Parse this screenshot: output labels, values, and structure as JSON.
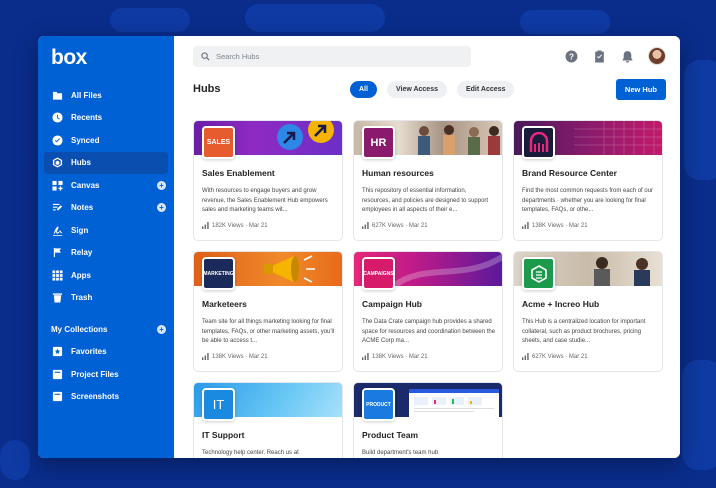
{
  "app": {
    "logo": "box"
  },
  "sidebar": {
    "items": [
      {
        "label": "All Files",
        "icon": "folder-icon"
      },
      {
        "label": "Recents",
        "icon": "clock-icon"
      },
      {
        "label": "Synced",
        "icon": "check-circle-icon"
      },
      {
        "label": "Hubs",
        "icon": "hub-icon",
        "active": true
      },
      {
        "label": "Canvas",
        "icon": "canvas-icon",
        "plus": true
      },
      {
        "label": "Notes",
        "icon": "notes-icon",
        "plus": true
      },
      {
        "label": "Sign",
        "icon": "sign-icon"
      },
      {
        "label": "Relay",
        "icon": "relay-icon"
      },
      {
        "label": "Apps",
        "icon": "apps-grid-icon"
      },
      {
        "label": "Trash",
        "icon": "trash-icon"
      }
    ],
    "collections_label": "My Collections",
    "collections": [
      {
        "label": "Favorites",
        "icon": "favorites-icon"
      },
      {
        "label": "Project Files",
        "icon": "collection-icon"
      },
      {
        "label": "Screenshots",
        "icon": "collection-icon"
      }
    ]
  },
  "search": {
    "placeholder": "Search Hubs"
  },
  "header": {
    "title": "Hubs",
    "filters": [
      "All",
      "View Access",
      "Edit Access"
    ],
    "new_hub_label": "New Hub"
  },
  "colors": {
    "brand": "#0061d5",
    "background": "#0a2d8c"
  },
  "hubs": [
    {
      "title": "Sales Enablement",
      "logo_text": "SALES",
      "desc": "With resources to engage buyers and grow revenue, the Sales Enablement Hub empowers sales and marketing teams wit...",
      "meta": "182K Views · Mar 21"
    },
    {
      "title": "Human resources",
      "logo_text": "HR",
      "desc": "This repository of essential information, resources, and policies are designed to support employees in all aspects of their e...",
      "meta": "627K Views · Mar 21"
    },
    {
      "title": "Brand Resource Center",
      "logo_text": "",
      "desc": "Find the most common requests from each of our departments · whether you are looking for final templates, FAQs, or othe...",
      "meta": "138K Views · Mar 21"
    },
    {
      "title": "Marketeers",
      "logo_text": "MARKETING",
      "desc": "Team site for all things marketing looking for final templates, FAQs, or other marketing assets, you'll be able to access t...",
      "meta": "138K Views · Mar 21"
    },
    {
      "title": "Campaign Hub",
      "logo_text": "CAMPAIGNS",
      "desc": "The Data Crate campaign hub provides a shared space for resources and coordination between the ACME Corp ma...",
      "meta": "138K Views · Mar 21"
    },
    {
      "title": "Acme + Increo Hub",
      "logo_text": "",
      "desc": "This Hub is a centralized location for important collateral, such as product brochures, pricing sheets, and case studie...",
      "meta": "627K Views · Mar 21"
    },
    {
      "title": "IT Support",
      "logo_text": "IT",
      "desc": "Technology help center. Reach us at",
      "meta": ""
    },
    {
      "title": "Product Team",
      "logo_text": "PRODUCT",
      "desc": "Build department's team hub",
      "meta": ""
    }
  ]
}
